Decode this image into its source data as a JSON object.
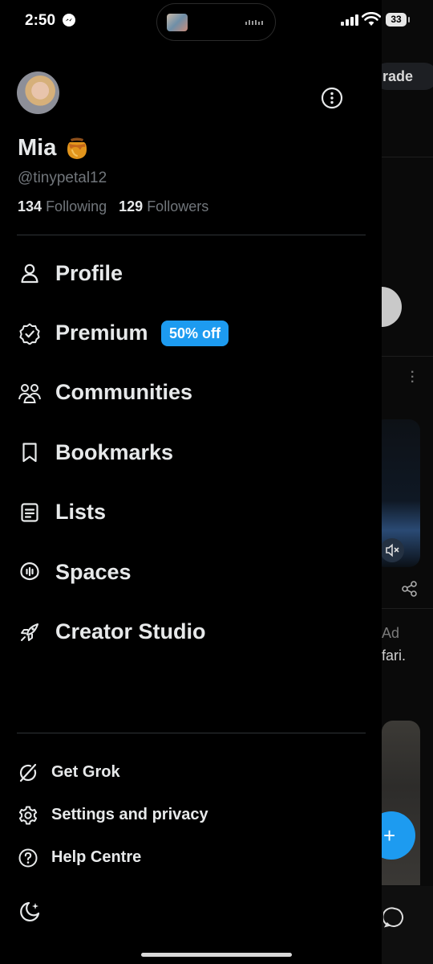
{
  "status_bar": {
    "time": "2:50",
    "battery": "33"
  },
  "drawer": {
    "profile": {
      "name": "Mia",
      "emoji": "🍯",
      "handle": "@tinypetal12",
      "following_count": "134",
      "following_label": "Following",
      "followers_count": "129",
      "followers_label": "Followers"
    },
    "menu": [
      {
        "label": "Profile",
        "icon": "person-icon"
      },
      {
        "label": "Premium",
        "icon": "verified-badge-icon",
        "badge": "50% off"
      },
      {
        "label": "Communities",
        "icon": "communities-icon"
      },
      {
        "label": "Bookmarks",
        "icon": "bookmark-icon"
      },
      {
        "label": "Lists",
        "icon": "list-icon"
      },
      {
        "label": "Spaces",
        "icon": "spaces-icon"
      },
      {
        "label": "Creator Studio",
        "icon": "rocket-icon"
      }
    ],
    "secondary": [
      {
        "label": "Get Grok",
        "icon": "grok-icon"
      },
      {
        "label": "Settings and privacy",
        "icon": "gear-icon"
      },
      {
        "label": "Help Centre",
        "icon": "help-icon"
      }
    ],
    "theme_icon": "moon-sparkle-icon"
  },
  "background_peek": {
    "upgrade_fragment": "rade",
    "ad_fragment": "Ad",
    "text_fragment": "fari."
  },
  "colors": {
    "background": "#000000",
    "text": "#e7e9ea",
    "muted": "#71767b",
    "accent": "#1d9bf0",
    "divider": "#2f3336"
  }
}
